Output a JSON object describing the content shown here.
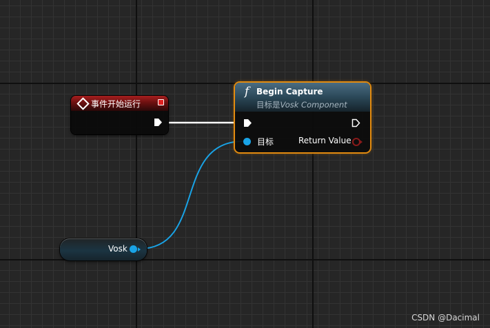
{
  "event_node": {
    "title": "事件开始运行"
  },
  "function_node": {
    "icon": "function-icon",
    "icon_glyph": "f",
    "title": "Begin Capture",
    "subtitle_prefix": "目标是",
    "subtitle_class": "Vosk Component",
    "target_label": "目标",
    "return_label": "Return Value"
  },
  "variable_node": {
    "label": "Vosk"
  },
  "watermark": "CSDN @Dacimal",
  "colors": {
    "event_header": "#a71f1f",
    "function_header": "#4a6c82",
    "selection_outline": "#e38b0f",
    "object_pin": "#19a3e6",
    "boolean_pin": "#8a1a1a",
    "exec_wire": "#ffffff",
    "grid_background": "#262626"
  }
}
